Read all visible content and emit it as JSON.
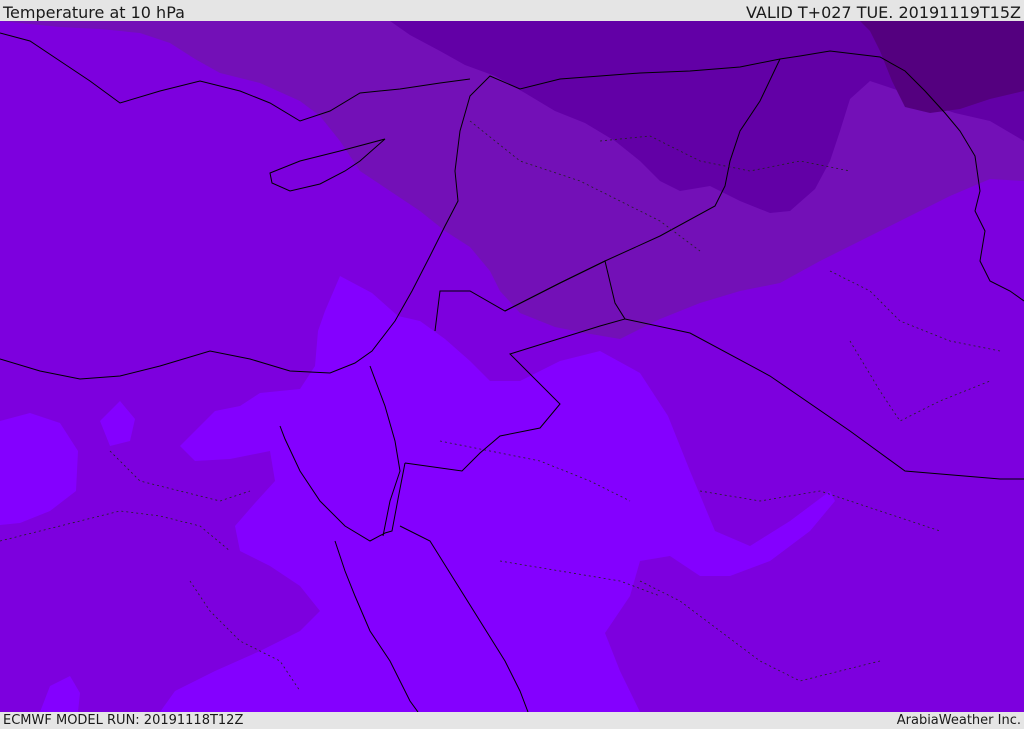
{
  "header": {
    "title": "Temperature at 10 hPa",
    "valid_time": "VALID T+027 TUE. 20191119T15Z"
  },
  "footer": {
    "model_run": "ECMWF MODEL RUN: 20191118T12Z",
    "credit": "ArabiaWeather Inc."
  },
  "map": {
    "variable": "temperature",
    "level": "10 hPa",
    "colors": {
      "band_darkest": "#54007f",
      "band_dark": "#6200a6",
      "band_mid_dark": "#7310b7",
      "band_mid": "#7d00de",
      "band_light": "#8400ff",
      "border_line": "#000000"
    }
  }
}
